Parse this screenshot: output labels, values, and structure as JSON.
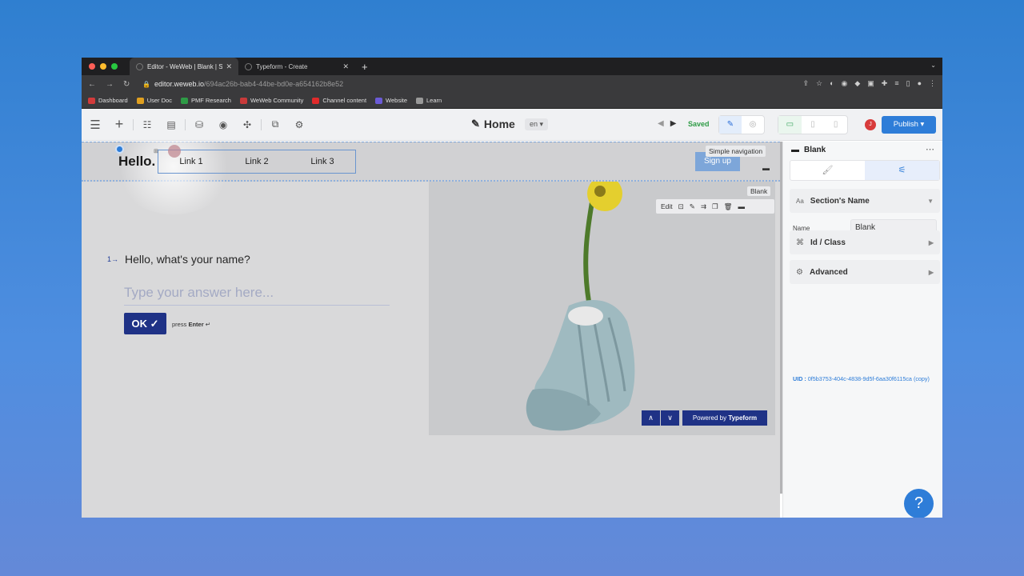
{
  "browser": {
    "tabs": [
      {
        "title": "Editor - WeWeb | Blank | Start"
      },
      {
        "title": "Typeform - Create"
      }
    ],
    "url_host": "editor.weweb.io",
    "url_path": "/694ac26b-bab4-44be-bd0e-a654162b8e52",
    "bookmarks": [
      {
        "label": "Dashboard",
        "color": "#d23b3b"
      },
      {
        "label": "User Doc",
        "color": "#e0a020"
      },
      {
        "label": "PMF Research",
        "color": "#2e9b46"
      },
      {
        "label": "WeWeb Community",
        "color": "#c83a3a"
      },
      {
        "label": "Channel content",
        "color": "#e02b2b"
      },
      {
        "label": "Website",
        "color": "#6b5bd6"
      },
      {
        "label": "Learn",
        "color": "#999999"
      }
    ]
  },
  "toolbar": {
    "page_name": "Home",
    "lang": "en",
    "saved": "Saved",
    "avatar": "J",
    "publish": "Publish"
  },
  "canvas": {
    "logo": "Hello.",
    "links": [
      "Link 1",
      "Link 2",
      "Link 3"
    ],
    "signup": "Sign up",
    "nav_label": "Simple navigation",
    "section_label": "Blank",
    "edit_label": "Edit"
  },
  "typeform": {
    "number": "1",
    "question": "Hello, what's your name?",
    "placeholder": "Type your answer here...",
    "ok": "OK",
    "press_prefix": "press",
    "press_key": "Enter",
    "powered_prefix": "Powered by",
    "powered_brand": "Typeform"
  },
  "panel": {
    "title": "Blank",
    "section_name": "Section's Name",
    "name_label": "Name",
    "name_value": "Blank",
    "id_class": "Id / Class",
    "advanced": "Advanced",
    "uid_label": "UID :",
    "uid_value": "0f5b3753-404c-4838-9d5f-6aa30f6115ca",
    "uid_copy": "(copy)"
  },
  "help": "?"
}
